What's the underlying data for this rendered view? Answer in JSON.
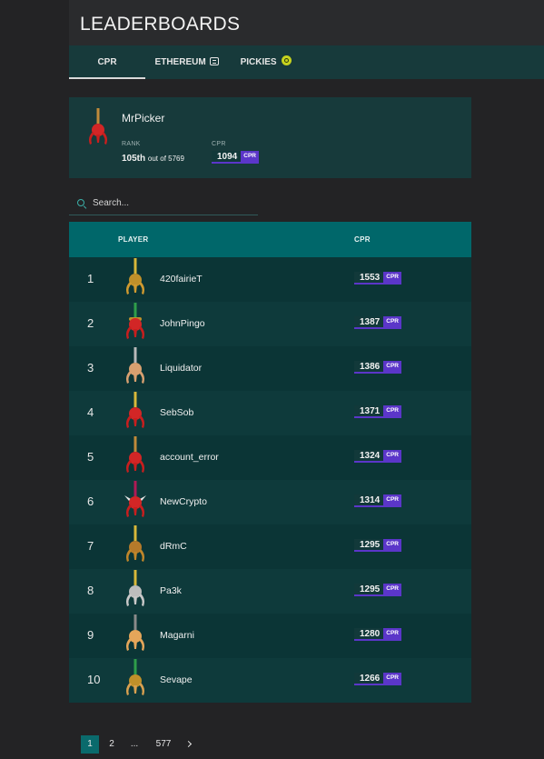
{
  "header": {
    "title": "LEADERBOARDS"
  },
  "tabs": [
    {
      "label": "CPR",
      "active": true
    },
    {
      "label": "ETHEREUM",
      "icon": "ethereum-icon"
    },
    {
      "label": "PICKIES",
      "icon": "pickies-coin-icon"
    }
  ],
  "profile": {
    "name": "MrPicker",
    "rank_label": "RANK",
    "rank": "105th",
    "rank_suffix": "out of 5769",
    "cpr_label": "CPR",
    "cpr_value": "1094",
    "cpr_unit": "CPR"
  },
  "search": {
    "placeholder": "Search..."
  },
  "table": {
    "columns": [
      "PLAYER",
      "CPR"
    ],
    "unit": "CPR",
    "rows": [
      {
        "rank": "1",
        "name": "420fairieT",
        "cpr": "1553"
      },
      {
        "rank": "2",
        "name": "JohnPingo",
        "cpr": "1387"
      },
      {
        "rank": "3",
        "name": "Liquidator",
        "cpr": "1386"
      },
      {
        "rank": "4",
        "name": "SebSob",
        "cpr": "1371"
      },
      {
        "rank": "5",
        "name": "account_error",
        "cpr": "1324"
      },
      {
        "rank": "6",
        "name": "NewCrypto",
        "cpr": "1314"
      },
      {
        "rank": "7",
        "name": "dRmC",
        "cpr": "1295"
      },
      {
        "rank": "8",
        "name": "Pa3k",
        "cpr": "1295"
      },
      {
        "rank": "9",
        "name": "Magarni",
        "cpr": "1280"
      },
      {
        "rank": "10",
        "name": "Sevape",
        "cpr": "1266"
      }
    ]
  },
  "pagination": {
    "pages": [
      "1",
      "2",
      "...",
      "577"
    ],
    "current": "1"
  },
  "colors": {
    "background": "#232325",
    "panel": "#173a3b",
    "table_header": "#00676a",
    "accent_purple": "#5b36c9",
    "pager_active": "#0a6a6c"
  }
}
